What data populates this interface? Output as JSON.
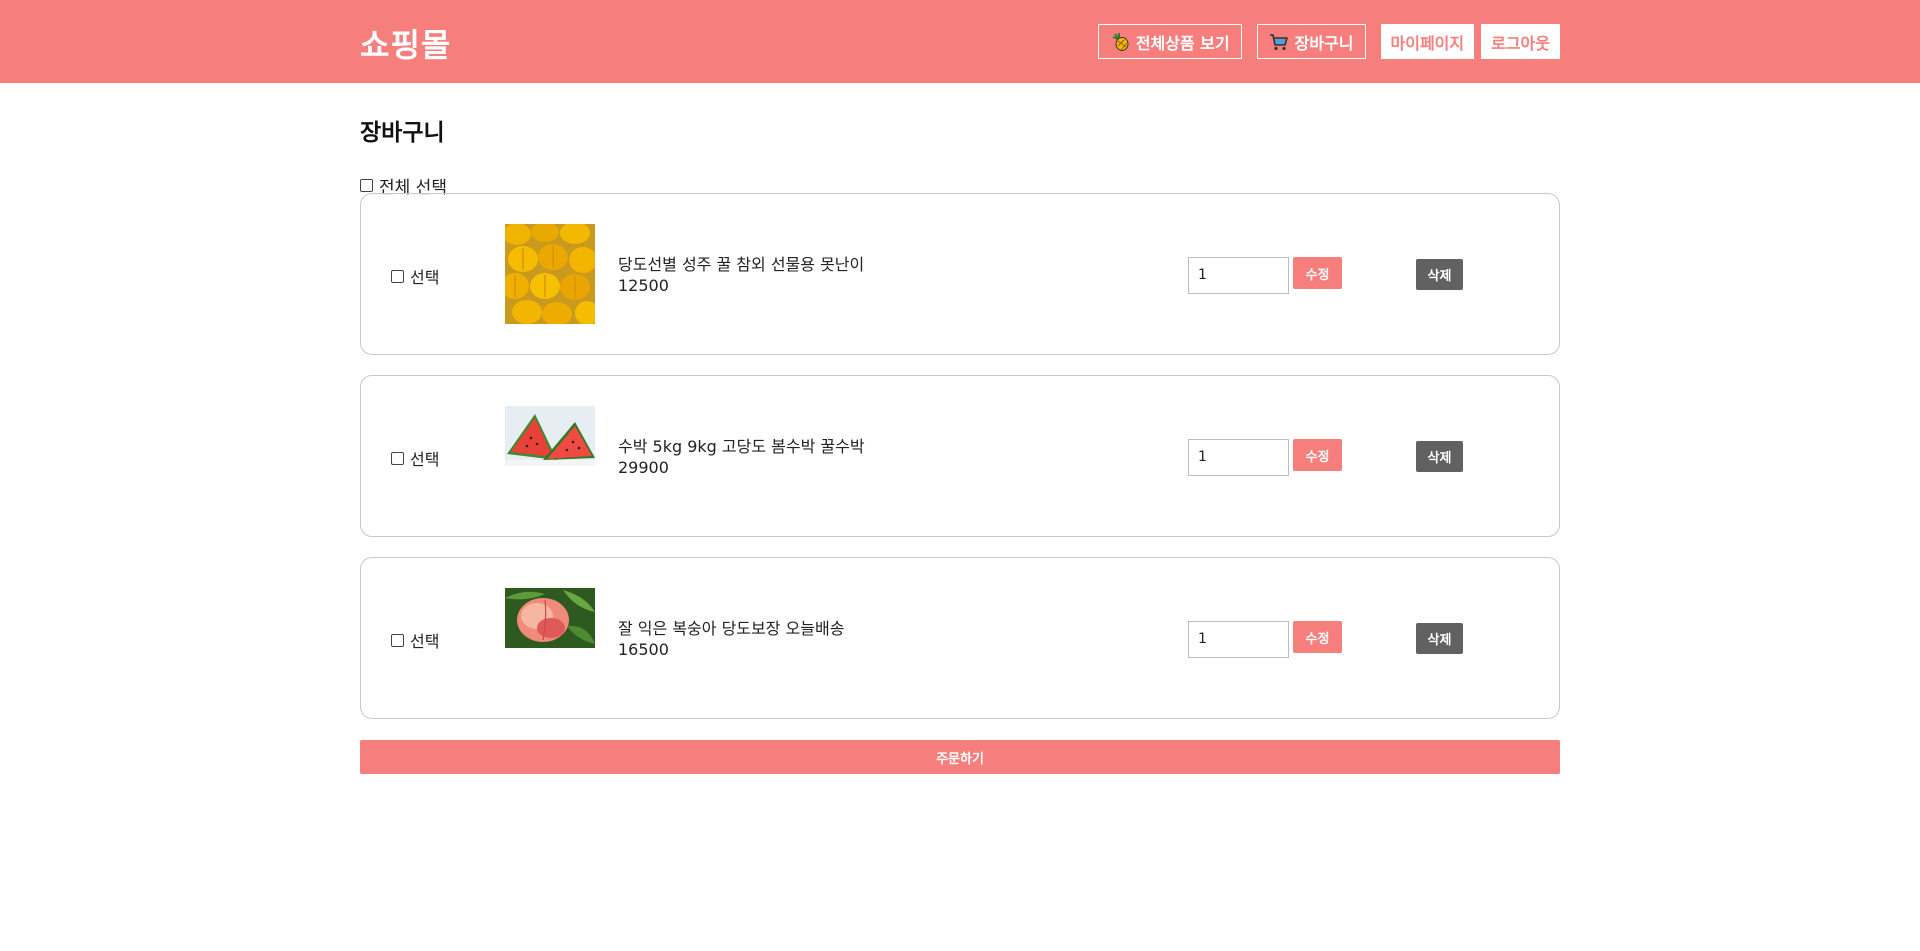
{
  "header": {
    "brand": "쇼핑몰",
    "nav": {
      "all_products": "전체상품 보기",
      "cart": "장바구니",
      "mypage": "마이페이지",
      "logout": "로그아웃"
    },
    "icons": [
      "pineapple-icon",
      "cart-icon"
    ]
  },
  "page": {
    "title": "장바구니",
    "select_all_label": "전체 선택"
  },
  "cart": {
    "items": [
      {
        "select_label": "선택",
        "name": "당도선별 성주 꿀 참외 선물용 못난이",
        "price": "12500",
        "quantity": "1",
        "edit_label": "수정",
        "delete_label": "삭제",
        "image": "korean-melon-image"
      },
      {
        "select_label": "선택",
        "name": "수박 5kg 9kg 고당도 봄수박 꿀수박",
        "price": "29900",
        "quantity": "1",
        "edit_label": "수정",
        "delete_label": "삭제",
        "image": "watermelon-image"
      },
      {
        "select_label": "선택",
        "name": "잘 익은 복숭아 당도보장 오늘배송",
        "price": "16500",
        "quantity": "1",
        "edit_label": "수정",
        "delete_label": "삭제",
        "image": "peach-image"
      }
    ],
    "order_label": "주문하기"
  },
  "colors": {
    "brand": "#f67f7d",
    "delete_button": "#616161",
    "card_border": "#c9c9c9"
  }
}
